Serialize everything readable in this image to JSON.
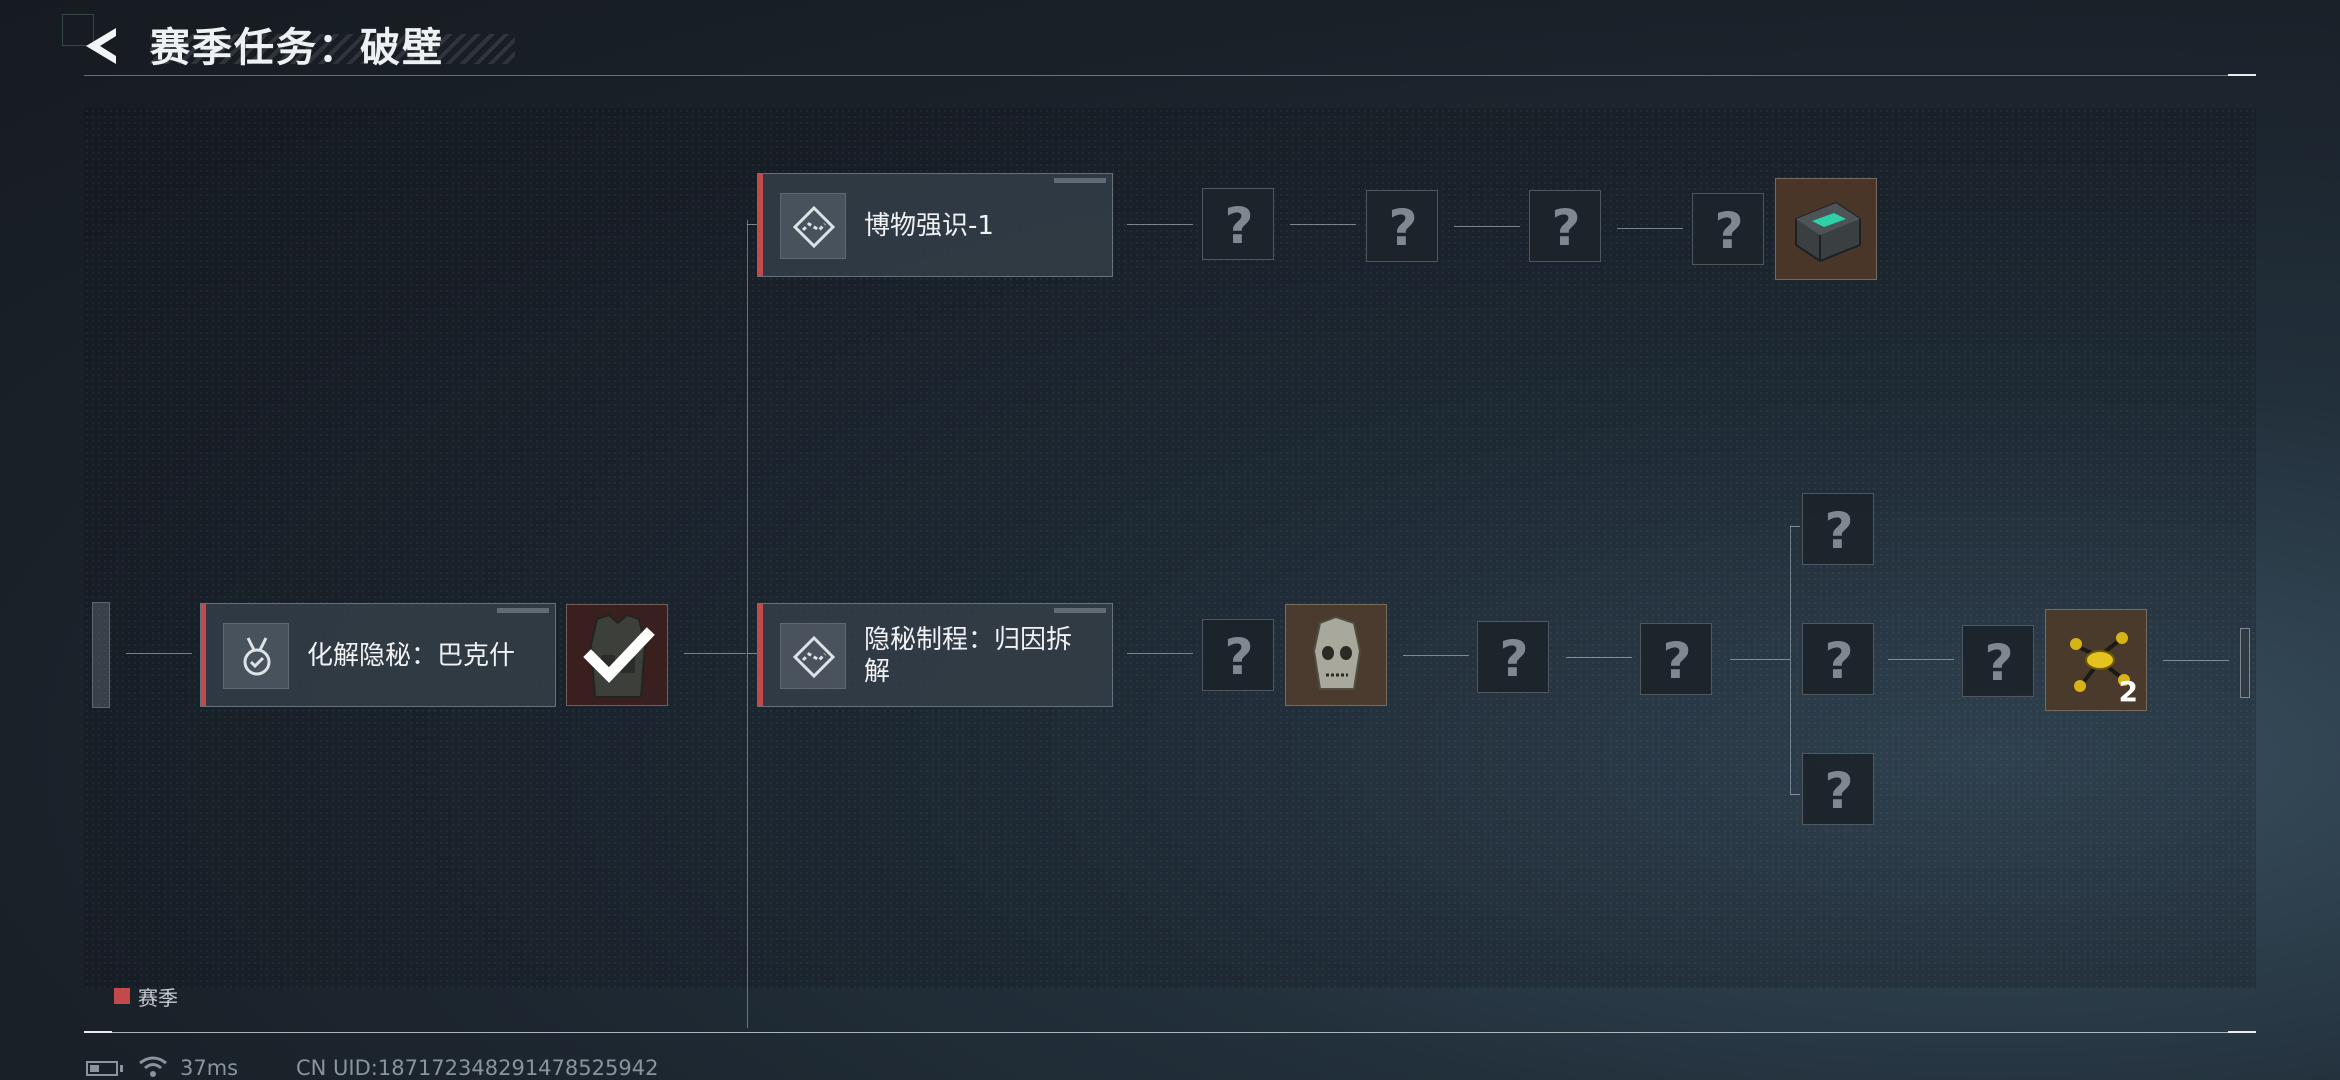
{
  "header": {
    "title": "赛季任务：破壁",
    "back_icon": "back-arrow-icon"
  },
  "tasks": [
    {
      "id": "top",
      "label": "博物强识-1",
      "icon": "route-diamond-icon",
      "status": "locked"
    },
    {
      "id": "left",
      "label": "化解隐秘：巴克什",
      "icon": "medal-icon",
      "status": "completed"
    },
    {
      "id": "mid",
      "label_line1": "隐秘制程：归因拆",
      "label_line2": "解",
      "icon": "route-diamond-icon",
      "status": "locked"
    }
  ],
  "rewards": {
    "unknown_symbol": "?",
    "left_task_reward": {
      "icon": "tactical-vest-icon",
      "completed": true
    },
    "top_final": {
      "icon": "equipment-case-icon"
    },
    "mid_item": {
      "icon": "skull-helmet-icon"
    },
    "mid_final": {
      "icon": "golden-drone-icon",
      "count": "2"
    }
  },
  "legend": {
    "label": "赛季",
    "color": "#c34a4a"
  },
  "status_bar": {
    "ping": "37ms",
    "uid": "CN UID:1871723482914785259​42"
  }
}
